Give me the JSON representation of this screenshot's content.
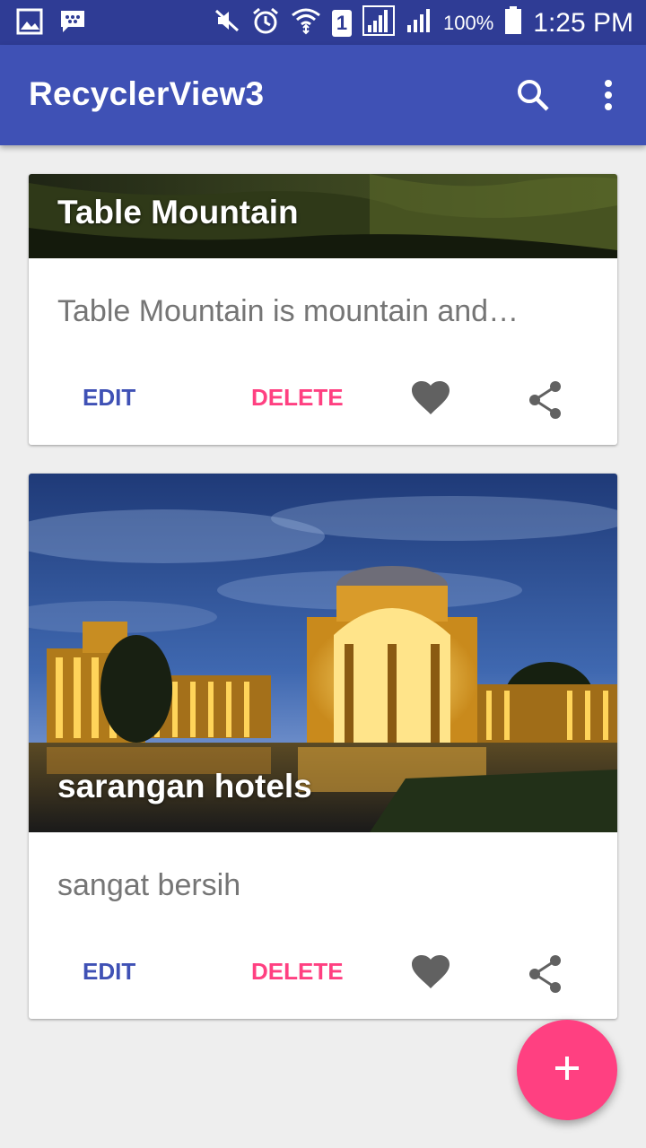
{
  "status_bar": {
    "battery_text": "100%",
    "time": "1:25 PM",
    "sim_label": "1",
    "icons": [
      "gallery-icon",
      "messenger-icon",
      "mute-icon",
      "alarm-icon",
      "wifi-icon",
      "sim-icon",
      "signal-icon",
      "signal-icon",
      "battery-icon"
    ]
  },
  "app_bar": {
    "title": "RecyclerView3",
    "icons": [
      "search-icon",
      "overflow-menu-icon"
    ]
  },
  "cards": [
    {
      "title": "Table Mountain",
      "description": "Table Mountain is mountain and…",
      "edit_label": "EDIT",
      "delete_label": "DELETE",
      "icons": [
        "heart-icon",
        "share-icon"
      ]
    },
    {
      "title": "sarangan hotels",
      "description": "sangat bersih",
      "edit_label": "EDIT",
      "delete_label": "DELETE",
      "icons": [
        "heart-icon",
        "share-icon"
      ]
    }
  ],
  "fab": {
    "icon": "plus-icon"
  },
  "colors": {
    "primary": "#3f51b5",
    "primary_dark": "#2f3c95",
    "accent": "#ff4081",
    "background": "#eeeeee",
    "secondary_text": "#757575",
    "icon_gray": "#616161"
  }
}
